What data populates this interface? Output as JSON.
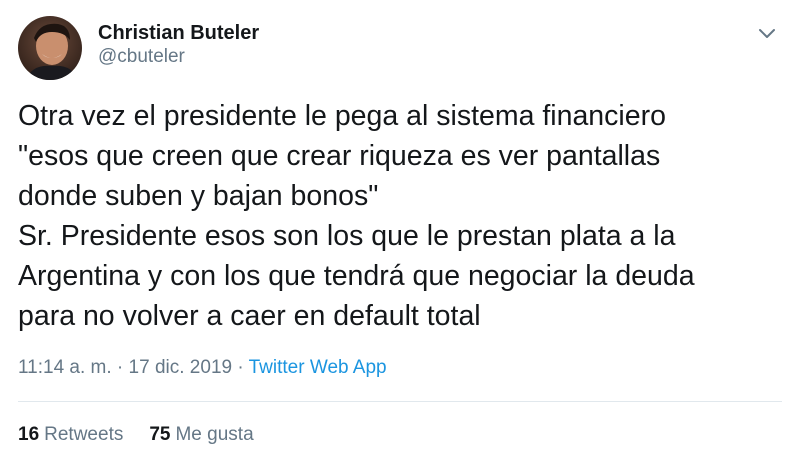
{
  "tweet": {
    "author": {
      "display_name": "Christian Buteler",
      "handle": "@cbuteler",
      "avatar_icon": "user-avatar"
    },
    "menu_icon": "chevron-down-icon",
    "text": "Otra vez el presidente le pega al sistema financiero\n\"esos que creen que crear riqueza es ver pantallas\ndonde suben y bajan bonos\"\nSr. Presidente esos son los que le prestan plata a la\nArgentina y con los que tendrá que negociar la deuda\npara no volver a caer en default total",
    "time": "11:14 a. m.",
    "separator": " · ",
    "date": "17 dic. 2019",
    "source": "Twitter Web App",
    "stats": {
      "retweets_count": "16",
      "retweets_label": "Retweets",
      "likes_count": "75",
      "likes_label": "Me gusta"
    }
  },
  "colors": {
    "text_primary": "#14171a",
    "text_secondary": "#657786",
    "link": "#1b95e0",
    "divider": "#e1e8ed"
  }
}
